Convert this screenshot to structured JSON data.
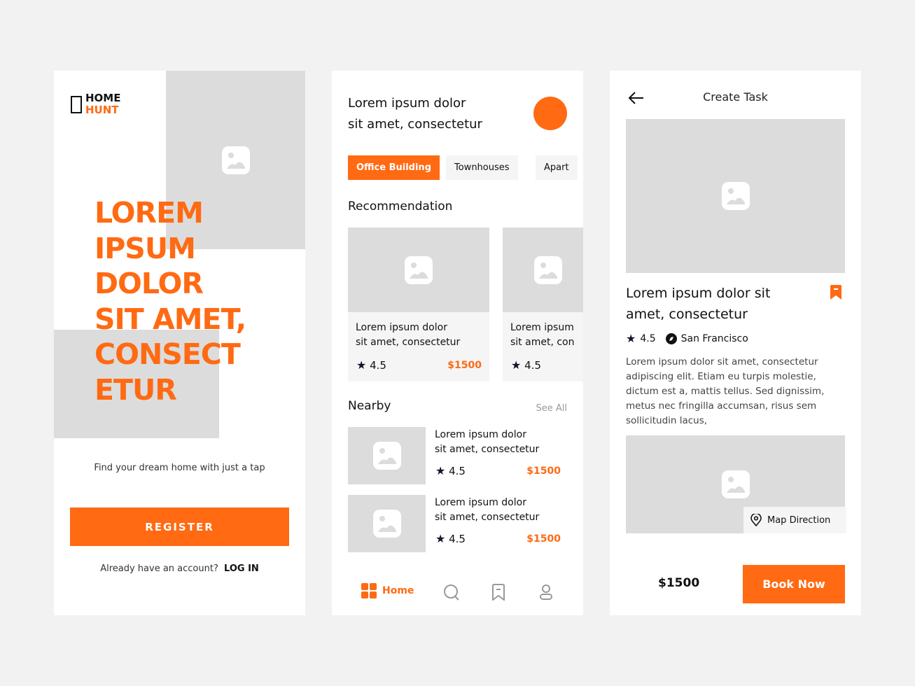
{
  "colors": {
    "accent": "#FF6A13",
    "placeholder": "#DCDCDC",
    "background": "#F2F2F2"
  },
  "welcome": {
    "logo_line1": "HOME",
    "logo_line2": "HUNT",
    "headline": [
      "LOREM",
      "IPSUM",
      "DOLOR",
      "SIT AMET,",
      "CONSECT",
      "ETUR"
    ],
    "tagline": "Find your dream home with just a tap",
    "register_label": "REGISTER",
    "account_prompt": "Already have an account?",
    "login_label": "LOG IN"
  },
  "home": {
    "greeting_line1": "Lorem ipsum dolor",
    "greeting_line2": "sit amet, consectetur",
    "chips": [
      "Office Building",
      "Townhouses",
      "Apart"
    ],
    "recommendation_title": "Recommendation",
    "recommendations": [
      {
        "title1": "Lorem ipsum dolor",
        "title2": "sit amet, consectetur",
        "rating": "4.5",
        "price": "$1500"
      },
      {
        "title1": "Lorem ipsum",
        "title2": "sit amet, con",
        "rating": "4.5"
      }
    ],
    "nearby_title": "Nearby",
    "see_all": "See All",
    "nearby": [
      {
        "title1": "Lorem ipsum dolor",
        "title2": "sit amet, consectetur",
        "rating": "4.5",
        "price": "$1500"
      },
      {
        "title1": "Lorem ipsum dolor",
        "title2": "sit amet, consectetur",
        "rating": "4.5",
        "price": "$1500"
      }
    ],
    "nav": {
      "home": "Home",
      "icons": [
        "home-grid-icon",
        "search-icon",
        "bookmark-icon",
        "profile-icon"
      ]
    }
  },
  "detail": {
    "header_title": "Create Task",
    "title_line1": "Lorem ipsum dolor sit",
    "title_line2": "amet, consectetur",
    "rating": "4.5",
    "location": "San Francisco",
    "description": "Lorem ipsum dolor sit amet, consectetur adipiscing elit. Etiam eu turpis molestie, dictum est a, mattis tellus. Sed dignissim, metus nec fringilla accumsan, risus sem sollicitudin lacus,",
    "map_direction": "Map Direction",
    "price": "$1500",
    "book_label": "Book Now"
  }
}
